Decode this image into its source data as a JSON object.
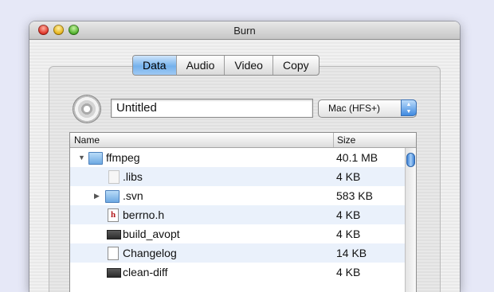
{
  "window": {
    "title": "Burn"
  },
  "tabs": [
    {
      "label": "Data",
      "active": true
    },
    {
      "label": "Audio",
      "active": false
    },
    {
      "label": "Video",
      "active": false
    },
    {
      "label": "Copy",
      "active": false
    }
  ],
  "disc_name": {
    "value": "Untitled"
  },
  "format_popup": {
    "value": "Mac (HFS+)"
  },
  "table": {
    "columns": {
      "name": "Name",
      "size": "Size"
    },
    "rows": [
      {
        "name": "ffmpeg",
        "size": "40.1 MB",
        "icon": "folder-icon",
        "disclosure": "expanded"
      },
      {
        "name": ".libs",
        "size": "4 KB",
        "icon": "document-icon",
        "disclosure": ""
      },
      {
        "name": ".svn",
        "size": "583 KB",
        "icon": "folder-icon",
        "disclosure": "collapsed"
      },
      {
        "name": "berrno.h",
        "size": "4 KB",
        "icon": "header-file-icon",
        "disclosure": ""
      },
      {
        "name": "build_avopt",
        "size": "4 KB",
        "icon": "executable-icon",
        "disclosure": ""
      },
      {
        "name": "Changelog",
        "size": "14 KB",
        "icon": "document-icon",
        "disclosure": ""
      },
      {
        "name": "clean-diff",
        "size": "4 KB",
        "icon": "executable-icon",
        "disclosure": ""
      }
    ]
  },
  "colors": {
    "accent": "#75b1ec",
    "row_stripe": "#eaf1fb"
  }
}
